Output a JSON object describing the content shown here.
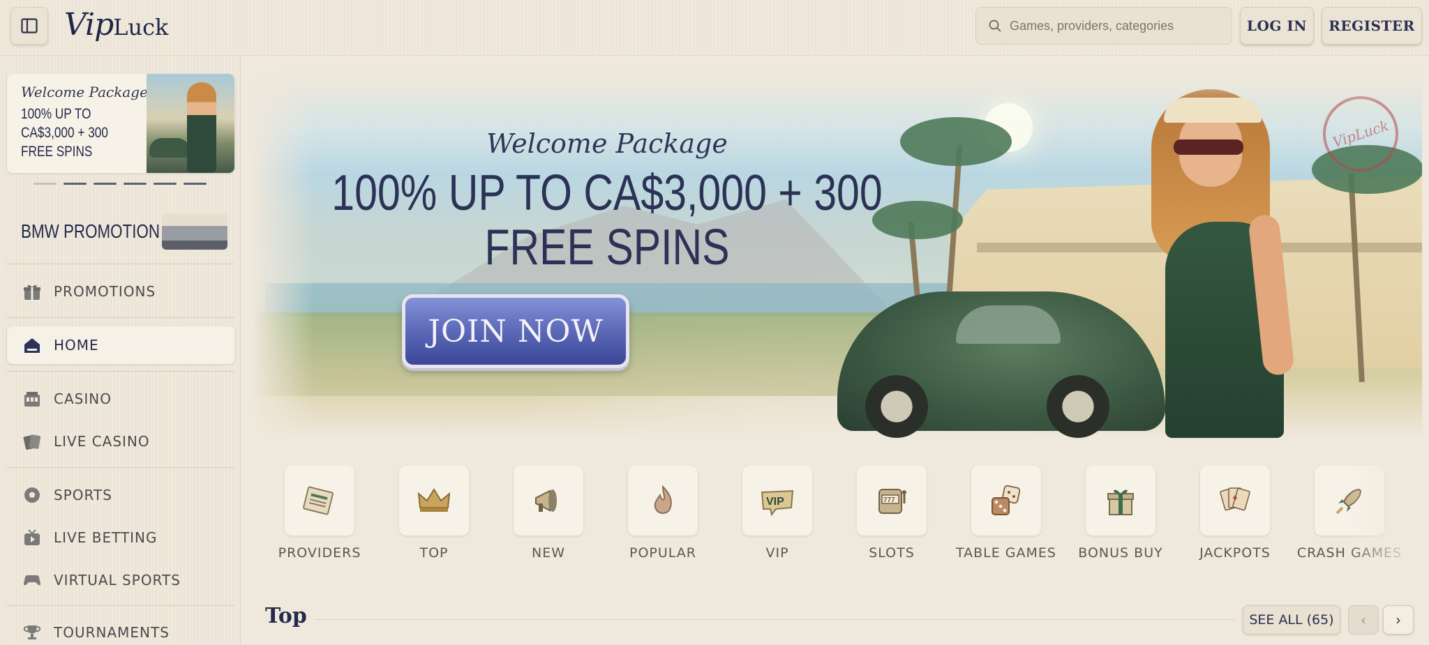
{
  "header": {
    "logo_vip": "Vip",
    "logo_luck": "Luck",
    "search_placeholder": "Games, providers, categories",
    "login_label": "LOG IN",
    "register_label": "REGISTER"
  },
  "sidebar": {
    "promo": {
      "script": "Welcome Package",
      "offer": "100% UP TO CA$3,000 + 300 FREE SPINS"
    },
    "carousel_dots": 6,
    "bmw_label": "BMW PROMOTION",
    "items": [
      {
        "label": "PROMOTIONS",
        "icon": "gift-icon"
      },
      {
        "label": "HOME",
        "icon": "home-icon",
        "active": true
      },
      {
        "label": "CASINO",
        "icon": "casino-icon"
      },
      {
        "label": "LIVE CASINO",
        "icon": "cards-icon"
      },
      {
        "label": "SPORTS",
        "icon": "ball-icon"
      },
      {
        "label": "LIVE BETTING",
        "icon": "tv-icon"
      },
      {
        "label": "VIRTUAL SPORTS",
        "icon": "gamepad-icon"
      },
      {
        "label": "TOURNAMENTS",
        "icon": "trophy-icon"
      }
    ]
  },
  "hero": {
    "script": "Welcome Package",
    "title_line1": "100% UP TO CA$3,000 + 300",
    "title_line2": "FREE SPINS",
    "cta": "JOIN NOW",
    "stamp": "VipLuck"
  },
  "categories": [
    {
      "label": "PROVIDERS",
      "icon": "newspaper-icon"
    },
    {
      "label": "TOP",
      "icon": "crown-icon"
    },
    {
      "label": "NEW",
      "icon": "megaphone-icon"
    },
    {
      "label": "POPULAR",
      "icon": "flame-icon"
    },
    {
      "label": "VIP",
      "icon": "vip-icon"
    },
    {
      "label": "SLOTS",
      "icon": "slot-machine-icon"
    },
    {
      "label": "TABLE GAMES",
      "icon": "dice-icon"
    },
    {
      "label": "BONUS BUY",
      "icon": "gift-box-icon"
    },
    {
      "label": "JACKPOTS",
      "icon": "playing-cards-icon"
    },
    {
      "label": "CRASH GAMES",
      "icon": "rocket-icon"
    }
  ],
  "top_section": {
    "title": "Top",
    "see_all": "SEE ALL (65)"
  },
  "colors": {
    "background": "#efe8dc",
    "navy": "#2b3255",
    "cta_blue": "#5765b4"
  }
}
